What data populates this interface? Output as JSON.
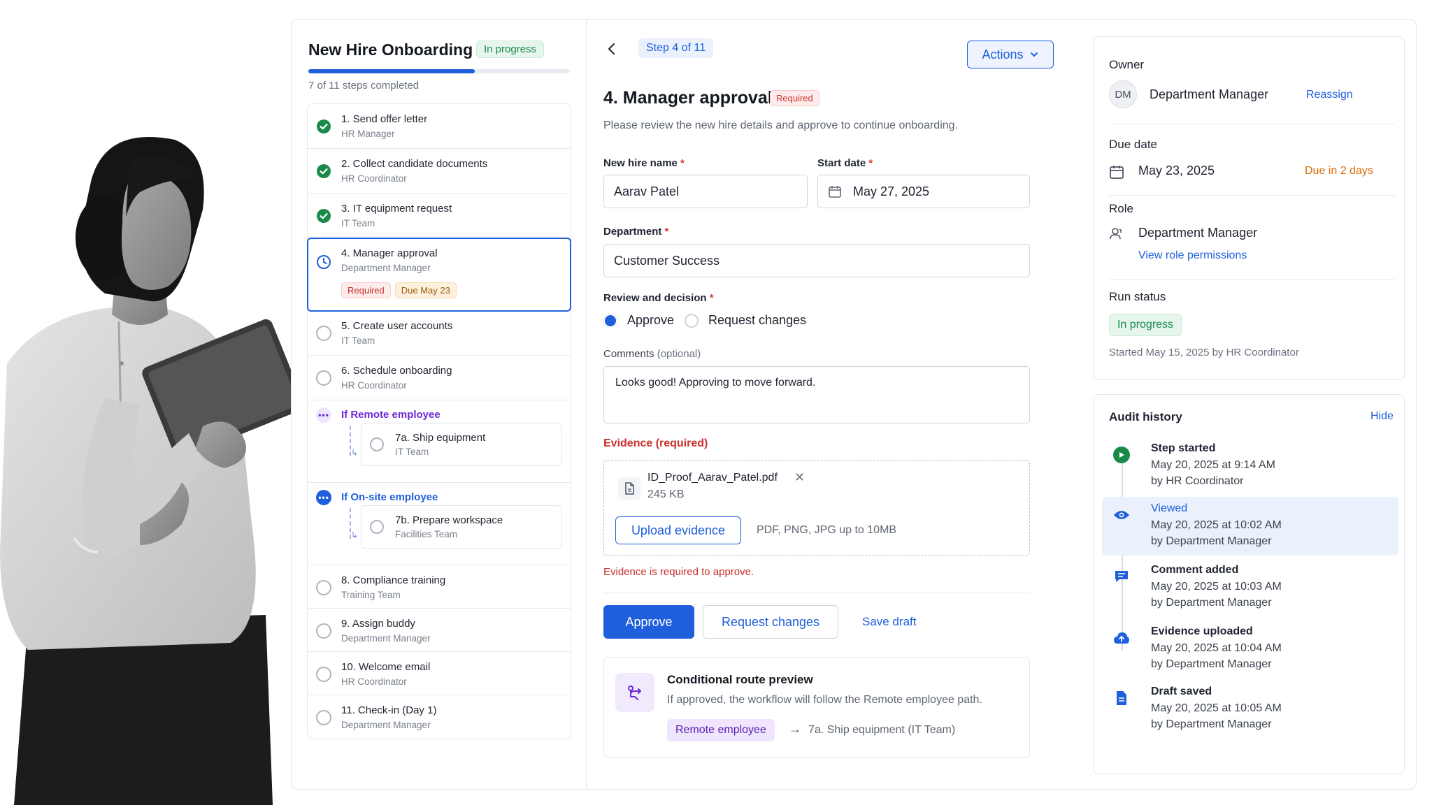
{
  "workflow": {
    "title": "New Hire Onboarding",
    "status": "In progress",
    "progress_fraction": 0.636,
    "progress_text": "7 of 11 steps completed"
  },
  "steps": [
    {
      "title": "1. Send offer letter",
      "owner": "HR Manager",
      "state": "done"
    },
    {
      "title": "2. Collect candidate documents",
      "owner": "HR Coordinator",
      "state": "done"
    },
    {
      "title": "3. IT equipment request",
      "owner": "IT Team",
      "state": "done"
    },
    {
      "title": "4. Manager approval",
      "owner": "Department Manager",
      "state": "active",
      "tags": [
        "Required",
        "Due May 23"
      ]
    },
    {
      "title": "5. Create user accounts",
      "owner": "IT Team",
      "state": "pending"
    },
    {
      "title": "6. Schedule onboarding",
      "owner": "HR Coordinator",
      "state": "pending"
    }
  ],
  "branches": [
    {
      "label": "If Remote employee",
      "color": "#6d28d9",
      "sub_title": "7a. Ship equipment",
      "sub_owner": "IT Team"
    },
    {
      "label": "If On-site employee",
      "color": "#1f5fdc",
      "sub_title": "7b. Prepare workspace",
      "sub_owner": "Facilities Team"
    }
  ],
  "steps_after": [
    {
      "title": "8. Compliance training",
      "owner": "Training Team"
    },
    {
      "title": "9. Assign buddy",
      "owner": "Department Manager"
    },
    {
      "title": "10. Welcome email",
      "owner": "HR Coordinator"
    },
    {
      "title": "11. Check-in (Day 1)",
      "owner": "Department Manager"
    }
  ],
  "form": {
    "step_chip": "Step 4 of 11",
    "actions_label": "Actions",
    "title": "4. Manager approval",
    "required_badge": "Required",
    "description": "Please review the new hire details and approve to continue onboarding.",
    "name_label": "New hire name",
    "name_value": "Aarav Patel",
    "start_label": "Start date",
    "start_value": "May 27, 2025",
    "dept_label": "Department",
    "dept_value": "Customer Success",
    "decision_label": "Review and decision",
    "option_approve": "Approve",
    "option_changes": "Request changes",
    "selected": "Approve",
    "comments_label": "Comments",
    "comments_optional": "(optional)",
    "comments_value": "Looks good! Approving to move forward.",
    "evidence_label": "Evidence (required)",
    "file_name": "ID_Proof_Aarav_Patel.pdf",
    "file_size": "245 KB",
    "upload_label": "Upload evidence",
    "upload_hint": "PDF, PNG, JPG up to 10MB",
    "evidence_error": "Evidence is required to approve.",
    "approve_btn": "Approve",
    "changes_btn": "Request changes",
    "save_draft": "Save draft",
    "preview_title": "Conditional route preview",
    "preview_desc": "If approved, the workflow will follow the Remote employee path.",
    "route_chip": "Remote employee",
    "route_target": "7a. Ship equipment (IT Team)"
  },
  "details": {
    "owner_label": "Owner",
    "owner_initials": "DM",
    "owner_name": "Department Manager",
    "reassign": "Reassign",
    "due_label": "Due date",
    "due_value": "May 23, 2025",
    "due_note": "Due in 2 days",
    "role_label": "Role",
    "role_value": "Department Manager",
    "role_link": "View role permissions",
    "run_label": "Run status",
    "run_value": "In progress",
    "run_note": "Started May 15, 2025 by HR Coordinator"
  },
  "audit": {
    "title": "Audit history",
    "hide": "Hide",
    "events": [
      {
        "icon": "play-icon",
        "title": "Step started",
        "time": "May 20, 2025 at 9:14 AM",
        "by": "by HR Coordinator"
      },
      {
        "icon": "eye-icon",
        "title": "Viewed",
        "time": "May 20, 2025 at 10:02 AM",
        "by": "by Department Manager"
      },
      {
        "icon": "comment-icon",
        "title": "Comment added",
        "time": "May 20, 2025 at 10:03 AM",
        "by": "by Department Manager"
      },
      {
        "icon": "upload-icon",
        "title": "Evidence uploaded",
        "time": "May 20, 2025 at 10:04 AM",
        "by": "by Department Manager"
      },
      {
        "icon": "document-icon",
        "title": "Draft saved",
        "time": "May 20, 2025 at 10:05 AM",
        "by": "by Department Manager"
      }
    ]
  },
  "colors": {
    "accent": "#1f5fdc",
    "success": "#1a8a4a",
    "danger": "#c8302a",
    "warning": "#d96b0b",
    "purple": "#6d28d9"
  }
}
